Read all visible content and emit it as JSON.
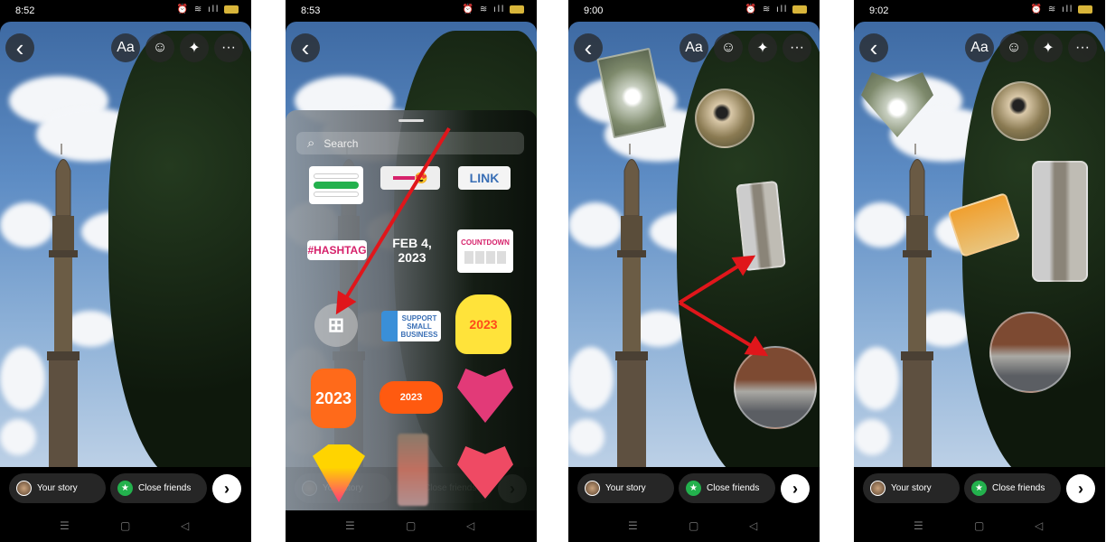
{
  "screens": [
    {
      "time": "8:52"
    },
    {
      "time": "8:53"
    },
    {
      "time": "9:00"
    },
    {
      "time": "9:02"
    }
  ],
  "toolbar": {
    "text_label": "Aa",
    "more_label": "···"
  },
  "bottom": {
    "your_story": "Your story",
    "close_friends": "Close friends"
  },
  "sticker_panel": {
    "search_placeholder": "Search",
    "link_label": "LINK",
    "hashtag_label": "#HASHTAG",
    "date_label": "FEB 4, 2023",
    "countdown_label": "COUNTDOWN",
    "support_label": "SUPPORT SMALL BUSINESS",
    "year_label": "2023"
  },
  "colors": {
    "arrow": "#e0161b",
    "close_friends": "#23b14d",
    "hashtag": "#d6226b"
  }
}
